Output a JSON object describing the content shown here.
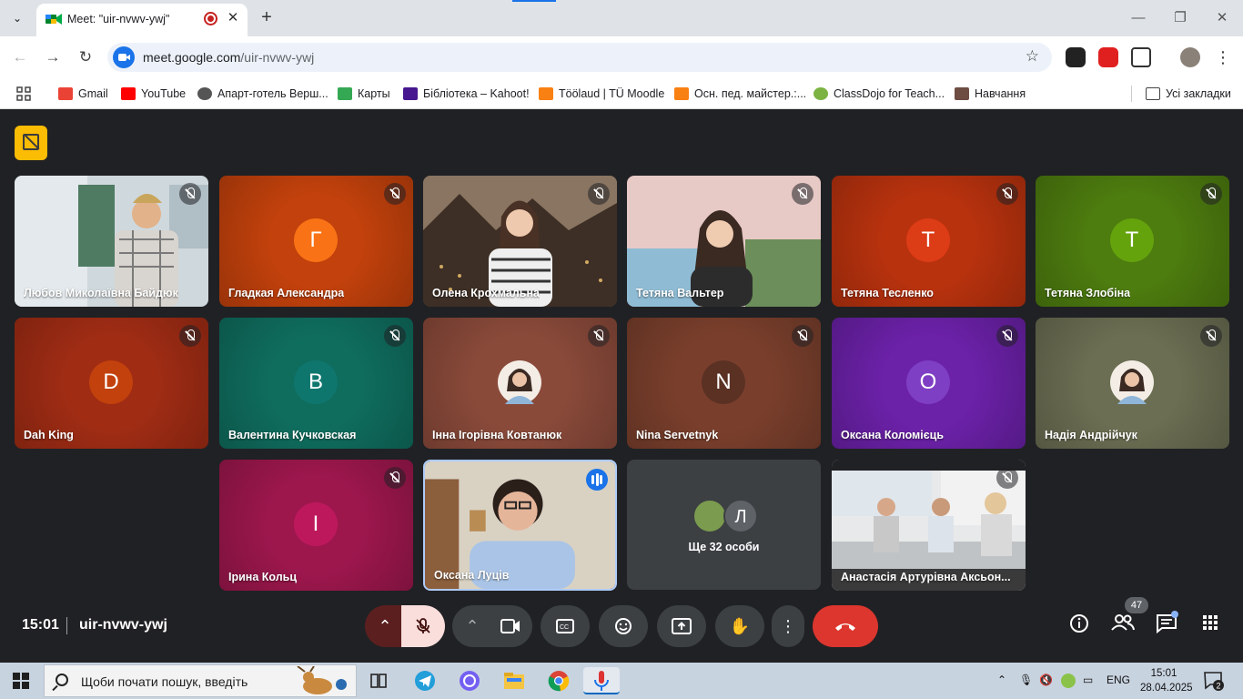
{
  "browser": {
    "tab_title": "Meet: \"uir-nvwv-ywj\"",
    "url_host": "meet.google.com",
    "url_path": "/uir-nvwv-ywj",
    "bookmarks": [
      {
        "label": "Gmail",
        "color": "#ea4335"
      },
      {
        "label": "YouTube",
        "color": "#ff0000"
      },
      {
        "label": "Апарт-готель Верш...",
        "color": "#333333"
      },
      {
        "label": "Карты",
        "color": "#34a853"
      },
      {
        "label": "Бібліотека – Kahoot!",
        "color": "#46178f"
      },
      {
        "label": "Töölaud | TÜ Moodle",
        "color": "#f98012"
      },
      {
        "label": "Осн. пед. майстер.:...",
        "color": "#f98012"
      },
      {
        "label": "ClassDojo for Teach...",
        "color": "#7cb342"
      },
      {
        "label": "Навчання",
        "color": "#6d4c41"
      }
    ],
    "all_bookmarks": "Усі закладки"
  },
  "meet": {
    "participants": [
      {
        "name": "Любов Миколаївна Байдюк",
        "type": "video",
        "scene": "classroom",
        "muted": true
      },
      {
        "name": "Гладкая Александра",
        "type": "avatar",
        "initial": "Г",
        "bg": "#c2410c",
        "circle": "#f97316",
        "muted": true
      },
      {
        "name": "Олена Крохмальна",
        "type": "video",
        "scene": "city",
        "muted": true
      },
      {
        "name": "Тетяна Вальтер",
        "type": "video",
        "scene": "pink",
        "muted": true
      },
      {
        "name": "Тетяна Тесленко",
        "type": "avatar",
        "initial": "T",
        "bg": "#b8320e",
        "circle": "#dc3c16",
        "muted": true
      },
      {
        "name": "Тетяна Злобіна",
        "type": "avatar",
        "initial": "T",
        "bg": "#4d7c0f",
        "circle": "#65a30d",
        "muted": true
      },
      {
        "name": "Dah King",
        "type": "avatar",
        "initial": "D",
        "bg": "#a02c14",
        "circle": "#c2410c",
        "muted": true
      },
      {
        "name": "Валентина Кучковская",
        "type": "avatar",
        "initial": "B",
        "bg": "#0f6d5e",
        "circle": "#0f766e",
        "muted": true
      },
      {
        "name": "Інна Ігорівна Ковтанюк",
        "type": "photo",
        "bg": "#8a4a3a",
        "muted": true
      },
      {
        "name": "Nina Servetnyk",
        "type": "avatar",
        "initial": "N",
        "bg": "#7a3f2c",
        "circle": "#5b3124",
        "muted": true
      },
      {
        "name": "Оксана Коломієць",
        "type": "avatar",
        "initial": "O",
        "bg": "#6b21a8",
        "circle": "#7e3fc4",
        "muted": true
      },
      {
        "name": "Надія Андрійчук",
        "type": "photo",
        "bg": "#6b6e52",
        "muted": true
      },
      {
        "name": "Ірина Кольц",
        "type": "avatar",
        "initial": "I",
        "bg": "#9d174d",
        "circle": "#be185d",
        "muted": true
      },
      {
        "name": "Оксана Луців",
        "type": "video",
        "scene": "speaker",
        "muted": false,
        "speaking": true
      },
      {
        "name": "Анастасія Артурівна Аксьон...",
        "type": "video",
        "scene": "room",
        "muted": true
      }
    ],
    "more_label": "Ще 32 особи",
    "more_initial": "Л",
    "time": "15:01",
    "meeting_code": "uir-nvwv-ywj",
    "people_count": "47"
  },
  "taskbar": {
    "search_placeholder": "Щоби почати пошук, введіть",
    "lang": "ENG",
    "time": "15:01",
    "date": "28.04.2025",
    "notifications": "2"
  }
}
